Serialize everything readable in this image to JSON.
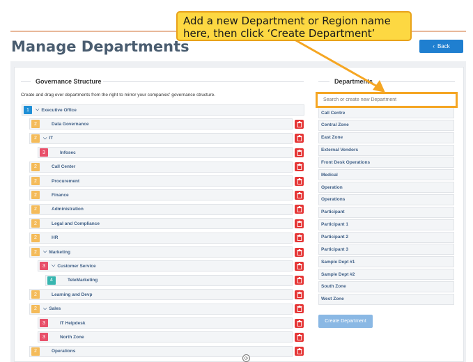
{
  "header": {
    "title": "Manage Departments",
    "back_label": "Back"
  },
  "callout": {
    "line1": "Add a new Department or Region name",
    "line2": "here, then click ‘Create Department’"
  },
  "governance": {
    "heading": "Governance Structure",
    "description": "Create and drag over departments from the right to mirror your companies' governance structure.",
    "rows": [
      {
        "level": "1",
        "label": "Executive Office",
        "chevron": true
      },
      {
        "level": "2",
        "label": "Data Governance",
        "chevron": false
      },
      {
        "level": "2",
        "label": "IT",
        "chevron": true
      },
      {
        "level": "3",
        "label": "Infosec",
        "chevron": false
      },
      {
        "level": "2",
        "label": "Call Center",
        "chevron": false
      },
      {
        "level": "2",
        "label": "Procurement",
        "chevron": false
      },
      {
        "level": "2",
        "label": "Finance",
        "chevron": false
      },
      {
        "level": "2",
        "label": "Administration",
        "chevron": false
      },
      {
        "level": "2",
        "label": "Legal and Compliance",
        "chevron": false
      },
      {
        "level": "2",
        "label": "HR",
        "chevron": false
      },
      {
        "level": "2",
        "label": "Marketing",
        "chevron": true
      },
      {
        "level": "3",
        "label": "Customer Service",
        "chevron": true
      },
      {
        "level": "4",
        "label": "TeleMarketing",
        "chevron": false
      },
      {
        "level": "2",
        "label": "Learning and Devp",
        "chevron": false
      },
      {
        "level": "2",
        "label": "Sales",
        "chevron": true
      },
      {
        "level": "3",
        "label": "IT Helpdesk",
        "chevron": false
      },
      {
        "level": "3",
        "label": "North Zone",
        "chevron": false
      },
      {
        "level": "2",
        "label": "Operations",
        "chevron": false
      }
    ]
  },
  "departments": {
    "heading": "Departments",
    "search_placeholder": "Search or create new Department",
    "items": [
      "Call Centre",
      "Central Zone",
      "East Zone",
      "External Vendors",
      "Front Desk Operations",
      "Medical",
      "Operation",
      "Operations",
      "Participant",
      "Participant 1",
      "Participant 2",
      "Participant 3",
      "Sample Dept #1",
      "Sample Dept #2",
      "South Zone",
      "West Zone"
    ],
    "create_label": "Create Department"
  },
  "colors": {
    "accent": "#1f7fd0",
    "callout_bg": "#fdd842",
    "callout_border": "#e8a21a",
    "delete": "#e53535"
  }
}
